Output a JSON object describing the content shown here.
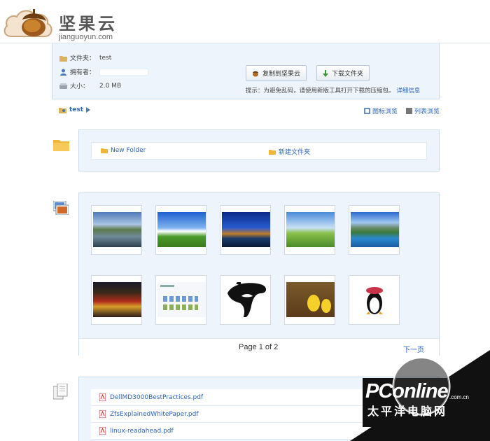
{
  "header": {
    "logo_text": "坚果云",
    "logo_sub": "jianguoyun.com"
  },
  "info": {
    "folder_label": "文件夹：",
    "folder_value": "test",
    "owner_label": "拥有者：",
    "size_label": "大小：",
    "size_value": "2.0 MB",
    "copy_button": "复制到坚果云",
    "download_button": "下载文件夹",
    "hint": "提示：为避免乱码，请使用新版工具打开下载的压缩包。",
    "hint_link": "详细信息"
  },
  "breadcrumb": {
    "current": "test"
  },
  "views": {
    "icon_view": "图标浏览",
    "list_view": "列表浏览"
  },
  "folders": {
    "items": [
      "New Folder",
      "新建文件夹"
    ]
  },
  "photos": {
    "pager_text": "Page 1 of 2",
    "next_label": "下一页"
  },
  "documents": {
    "items": [
      "DellMD3000BestPractices.pdf",
      "ZfsExplainedWhitePaper.pdf",
      "linux-readahead.pdf"
    ]
  },
  "watermark": {
    "brand": "PConline",
    "url": ".com.cn",
    "cn": "太平洋电脑网"
  },
  "colors": {
    "panel_bg": "#eef4fb",
    "panel_border": "#c9dbef",
    "link": "#2a66b8"
  }
}
